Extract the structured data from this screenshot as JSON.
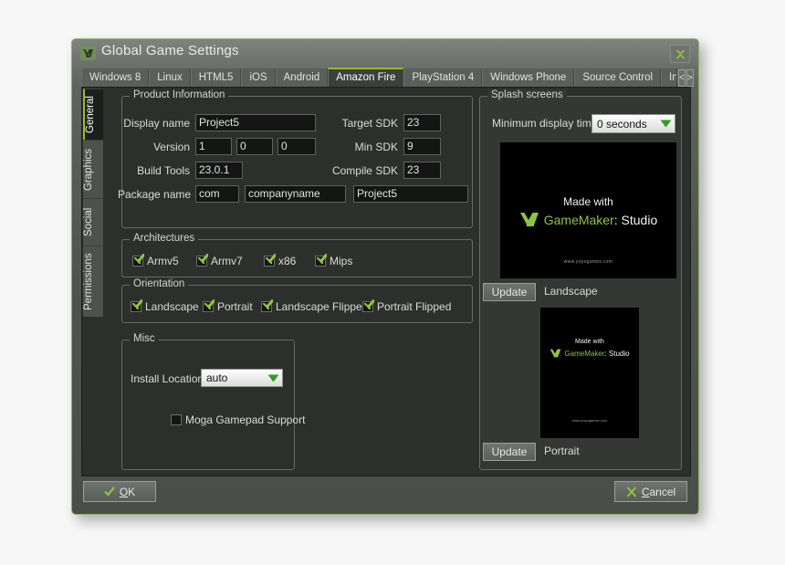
{
  "window": {
    "title": "Global Game Settings",
    "logo_icon": "gamemaker-logo-icon",
    "close_icon": "close-icon"
  },
  "platform_tabs": {
    "items": [
      {
        "label": "Windows 8",
        "active": false
      },
      {
        "label": "Linux",
        "active": false
      },
      {
        "label": "HTML5",
        "active": false
      },
      {
        "label": "iOS",
        "active": false
      },
      {
        "label": "Android",
        "active": false
      },
      {
        "label": "Amazon Fire",
        "active": true
      },
      {
        "label": "PlayStation 4",
        "active": false
      },
      {
        "label": "Windows Phone",
        "active": false
      },
      {
        "label": "Source Control",
        "active": false
      },
      {
        "label": "In App Purchase",
        "active": false
      }
    ],
    "nav_prev": "<",
    "nav_next": ">"
  },
  "side_tabs": {
    "items": [
      {
        "label": "General",
        "active": true
      },
      {
        "label": "Graphics",
        "active": false
      },
      {
        "label": "Social",
        "active": false
      },
      {
        "label": "Permissions",
        "active": false
      }
    ]
  },
  "product_information": {
    "legend": "Product Information",
    "display_name_label": "Display name",
    "display_name_value": "Project5",
    "version_label": "Version",
    "version_major": "1",
    "version_minor": "0",
    "version_build": "0",
    "build_tools_label": "Build Tools",
    "build_tools_value": "23.0.1",
    "package_name_label": "Package name",
    "package_part1": "com",
    "package_part2": "companyname",
    "package_part3": "Project5",
    "target_sdk_label": "Target SDK",
    "target_sdk_value": "23",
    "min_sdk_label": "Min SDK",
    "min_sdk_value": "9",
    "compile_sdk_label": "Compile SDK",
    "compile_sdk_value": "23"
  },
  "architectures": {
    "legend": "Architectures",
    "items": [
      {
        "label": "Armv5",
        "checked": true
      },
      {
        "label": "Armv7",
        "checked": true
      },
      {
        "label": "x86",
        "checked": true
      },
      {
        "label": "Mips",
        "checked": true
      }
    ]
  },
  "orientation": {
    "legend": "Orientation",
    "items": [
      {
        "label": "Landscape",
        "checked": true
      },
      {
        "label": "Portrait",
        "checked": true
      },
      {
        "label": "Landscape Flipped",
        "checked": true
      },
      {
        "label": "Portrait Flipped",
        "checked": true
      }
    ]
  },
  "misc": {
    "legend": "Misc",
    "install_location_label": "Install Location:",
    "install_location_value": "auto",
    "dropdown_icon": "chevron-down-icon",
    "moga_label": "Moga Gamepad Support",
    "moga_checked": false
  },
  "splash_screens": {
    "legend": "Splash screens",
    "min_display_time_label": "Minimum display time:",
    "min_display_time_value": "0 seconds",
    "dropdown_icon": "chevron-down-icon",
    "landscape": {
      "update_label": "Update",
      "caption": "Landscape",
      "made_with": "Made with",
      "brand_1": "GameMaker",
      "brand_2": ": Studio",
      "url": "www.yoyogames.com"
    },
    "portrait": {
      "update_label": "Update",
      "caption": "Portrait",
      "made_with": "Made with",
      "brand_1": "GameMaker",
      "brand_2": ": Studio",
      "url": "www.yoyogames.com"
    }
  },
  "footer": {
    "ok_label_underline": "O",
    "ok_label_rest": "K",
    "ok_icon": "check-icon",
    "cancel_label_underline": "C",
    "cancel_label_rest": "ancel",
    "cancel_icon": "cross-icon"
  },
  "colors": {
    "accent_green": "#93c020",
    "check_green": "#8ec63f",
    "dialog_bg": "#4e534d",
    "content_bg": "#2d2f2c",
    "input_bg": "#141514"
  }
}
